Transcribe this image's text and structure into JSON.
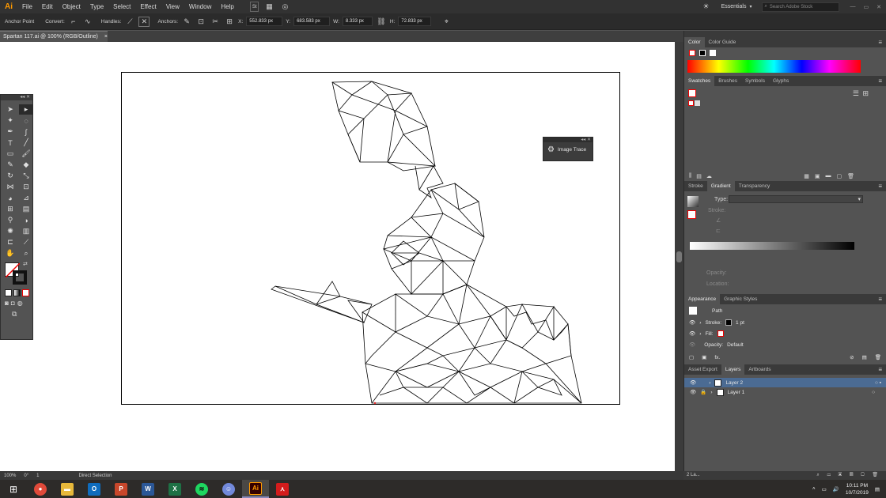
{
  "app": {
    "logo": "Ai",
    "menus": [
      "File",
      "Edit",
      "Object",
      "Type",
      "Select",
      "Effect",
      "View",
      "Window",
      "Help"
    ],
    "workspace": "Essentials",
    "search_placeholder": "Search Adobe Stock",
    "bridge": "Br",
    "stock": "St"
  },
  "control": {
    "mode": "Anchor Point",
    "convert": "Convert:",
    "handles": "Handles:",
    "anchors": "Anchors:",
    "x_label": "X:",
    "x": "552.833 px",
    "y_label": "Y:",
    "y": "683.583 px",
    "w_label": "W:",
    "w": "8.333 px",
    "h_label": "H:",
    "h": "72.833 px"
  },
  "document": {
    "tab": "Spartan 117.ai @ 100% (RGB/Outline)",
    "close": "×"
  },
  "image_trace": {
    "label": "Image Trace"
  },
  "panels": {
    "color_tabs": [
      "Color",
      "Color Guide"
    ],
    "swatch_tabs": [
      "Swatches",
      "Brushes",
      "Symbols",
      "Glyphs"
    ],
    "gradient_tabs": [
      "Stroke",
      "Gradient",
      "Transparency"
    ],
    "gradient": {
      "type_label": "Type:",
      "stroke_label": "Stroke:",
      "opacity_label": "Opacity:",
      "location_label": "Location:"
    },
    "appearance_tabs": [
      "Appearance",
      "Graphic Styles"
    ],
    "appearance": {
      "object": "Path",
      "stroke_label": "Stroke:",
      "stroke_value": "1 pt",
      "fill_label": "Fill:",
      "opacity_label": "Opacity:",
      "opacity_value": "Default",
      "fx": "fx."
    },
    "layer_tabs": [
      "Asset Export",
      "Layers",
      "Artboards"
    ],
    "layers": [
      {
        "name": "Layer 2",
        "selected": true
      },
      {
        "name": "Layer 1",
        "selected": false
      }
    ],
    "layer_count": "2 La..."
  },
  "status": {
    "zoom": "100%",
    "angle": "0°",
    "page": "1",
    "tool": "Direct Selection"
  },
  "taskbar": {
    "time": "10:11 PM",
    "date": "10/7/2019",
    "apps": [
      {
        "name": "windows",
        "glyph": "",
        "color": "#ffffff"
      },
      {
        "name": "chrome",
        "glyph": "",
        "color": "#e04a3a"
      },
      {
        "name": "file-explorer",
        "glyph": "",
        "color": "#e7b83a"
      },
      {
        "name": "outlook",
        "glyph": "O",
        "color": "#0f6cbd"
      },
      {
        "name": "powerpoint",
        "glyph": "P",
        "color": "#c8472b"
      },
      {
        "name": "word",
        "glyph": "W",
        "color": "#2b5797"
      },
      {
        "name": "excel",
        "glyph": "X",
        "color": "#1e7145"
      },
      {
        "name": "spotify",
        "glyph": "",
        "color": "#1ed760"
      },
      {
        "name": "discord",
        "glyph": "",
        "color": "#7289da"
      },
      {
        "name": "illustrator",
        "glyph": "Ai",
        "color": "#ff9a00"
      },
      {
        "name": "acrobat",
        "glyph": "",
        "color": "#d31c1c"
      }
    ]
  }
}
